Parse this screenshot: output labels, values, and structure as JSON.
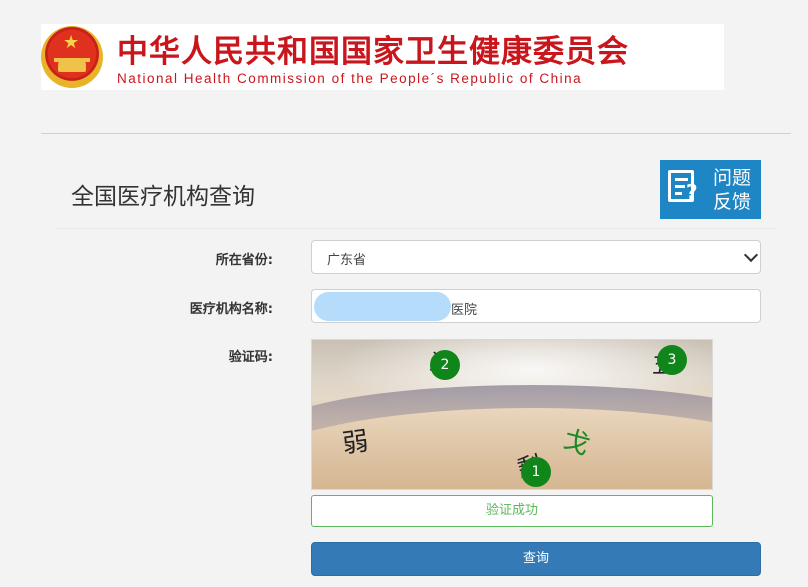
{
  "header": {
    "title_cn": "中华人民共和国国家卫生健康委员会",
    "title_en": "National Health Commission of the People´s Republic of China"
  },
  "page": {
    "title": "全国医疗机构查询",
    "feedback_line1": "问题",
    "feedback_line2": "反馈"
  },
  "form": {
    "province_label": "所在省份:",
    "province_value": "广东省",
    "institution_label": "医疗机构名称:",
    "institution_suffix": "医院",
    "captcha_label": "验证码:"
  },
  "captcha": {
    "chars": [
      "弱",
      "戈",
      "剩",
      "游",
      "五"
    ],
    "markers": [
      "1",
      "2",
      "3"
    ],
    "status": "验证成功"
  },
  "actions": {
    "query_label": "查询"
  },
  "colors": {
    "brand_red": "#c9161d",
    "primary_blue": "#337ab7",
    "success_green": "#5cb85c",
    "marker_green": "#10861a"
  }
}
